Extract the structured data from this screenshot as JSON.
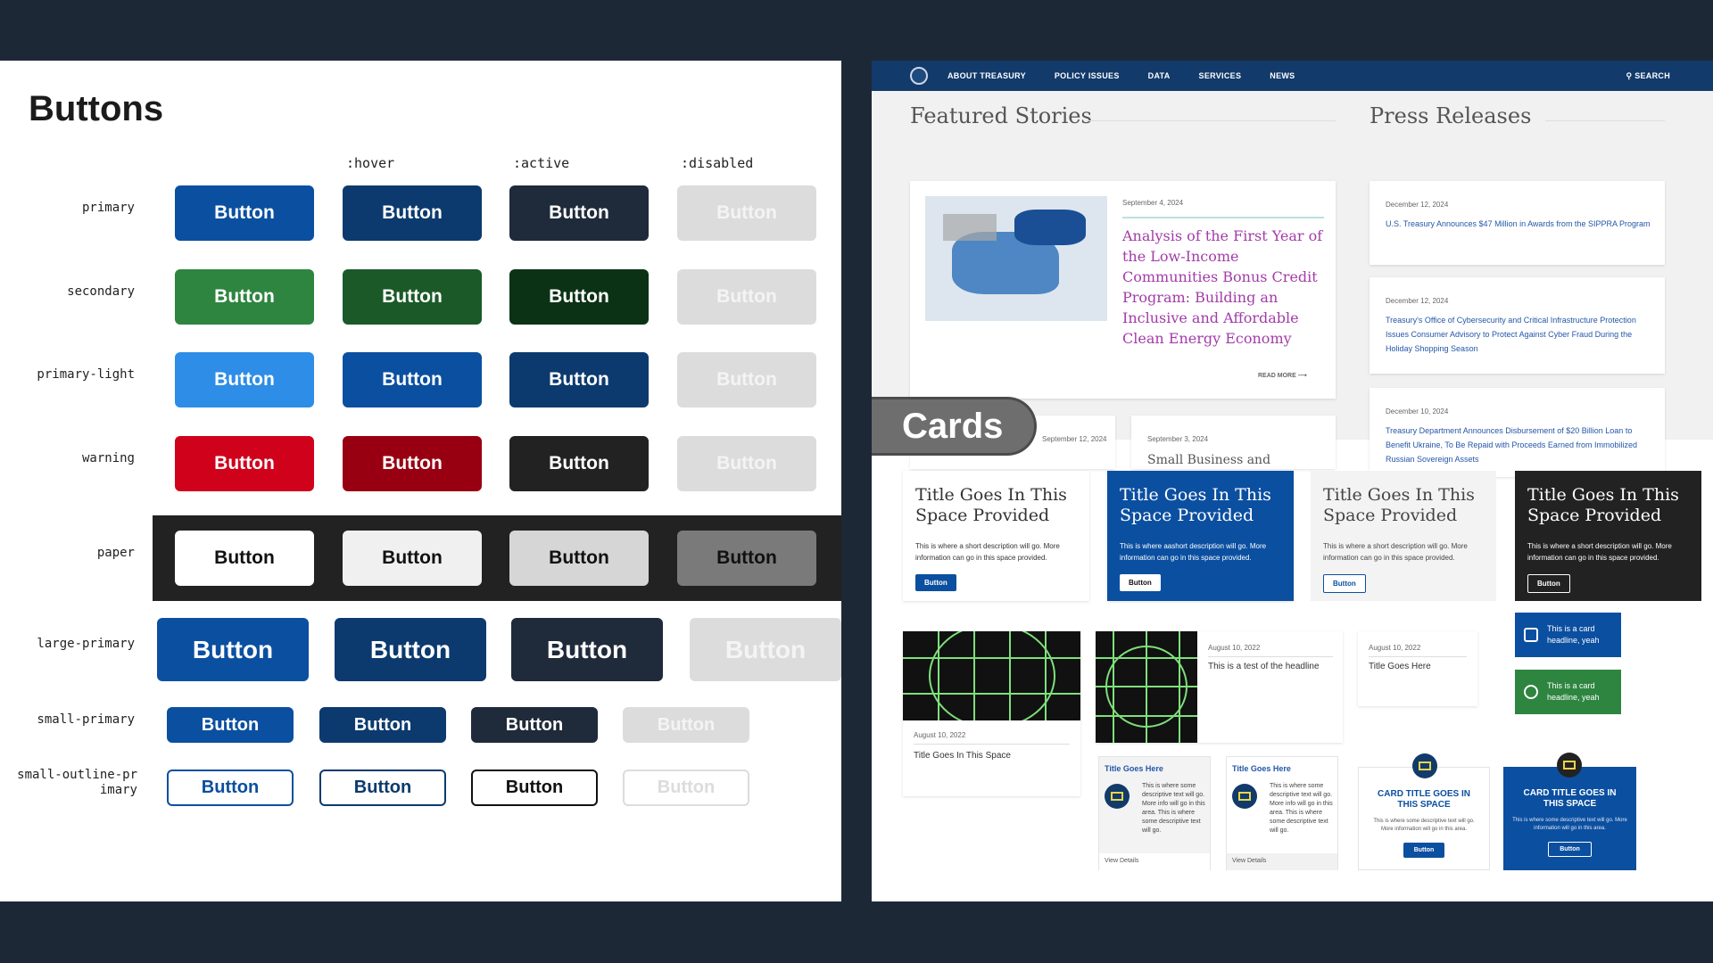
{
  "buttons_panel": {
    "title": "Buttons",
    "state_headers": [
      ":hover",
      ":active",
      ":disabled"
    ],
    "button_label": "Button",
    "rows": [
      {
        "label": "primary",
        "styles": [
          {
            "bg": "#0b4fa0",
            "fg": "#fff",
            "border": "#0b4fa0"
          },
          {
            "bg": "#0c3a6e",
            "fg": "#fff",
            "border": "#0c3a6e"
          },
          {
            "bg": "#1f2a3a",
            "fg": "#fff",
            "border": "#1f2a3a"
          },
          {
            "bg": "#dcdcdc",
            "fg": "#f4f4f4",
            "border": "#dcdcdc"
          }
        ]
      },
      {
        "label": "secondary",
        "styles": [
          {
            "bg": "#2e8540",
            "fg": "#fff",
            "border": "#2e8540"
          },
          {
            "bg": "#1b5a28",
            "fg": "#fff",
            "border": "#1b5a28"
          },
          {
            "bg": "#0c3215",
            "fg": "#fff",
            "border": "#0c3215"
          },
          {
            "bg": "#dcdcdc",
            "fg": "#f4f4f4",
            "border": "#dcdcdc"
          }
        ]
      },
      {
        "label": "primary-light",
        "styles": [
          {
            "bg": "#2e8de6",
            "fg": "#fff",
            "border": "#2e8de6"
          },
          {
            "bg": "#0b4fa0",
            "fg": "#fff",
            "border": "#0b4fa0"
          },
          {
            "bg": "#0c3a6e",
            "fg": "#fff",
            "border": "#0c3a6e"
          },
          {
            "bg": "#dcdcdc",
            "fg": "#f4f4f4",
            "border": "#dcdcdc"
          }
        ]
      },
      {
        "label": "warning",
        "styles": [
          {
            "bg": "#d0021b",
            "fg": "#fff",
            "border": "#d0021b"
          },
          {
            "bg": "#980012",
            "fg": "#fff",
            "border": "#980012"
          },
          {
            "bg": "#222222",
            "fg": "#fff",
            "border": "#222222"
          },
          {
            "bg": "#dcdcdc",
            "fg": "#f4f4f4",
            "border": "#dcdcdc"
          }
        ]
      },
      {
        "label": "paper",
        "styles": [
          {
            "bg": "#ffffff",
            "fg": "#111",
            "border": "#ffffff"
          },
          {
            "bg": "#f0f0f0",
            "fg": "#111",
            "border": "#f0f0f0"
          },
          {
            "bg": "#d6d6d6",
            "fg": "#111",
            "border": "#d6d6d6"
          },
          {
            "bg": "#7a7a7a",
            "fg": "#111",
            "border": "#7a7a7a"
          }
        ]
      },
      {
        "label": "large-primary",
        "styles": [
          {
            "bg": "#0b4fa0",
            "fg": "#fff",
            "border": "#0b4fa0"
          },
          {
            "bg": "#0c3a6e",
            "fg": "#fff",
            "border": "#0c3a6e"
          },
          {
            "bg": "#1f2a3a",
            "fg": "#fff",
            "border": "#1f2a3a"
          },
          {
            "bg": "#dcdcdc",
            "fg": "#f4f4f4",
            "border": "#dcdcdc"
          }
        ]
      },
      {
        "label": "small-primary",
        "styles": [
          {
            "bg": "#0b4fa0",
            "fg": "#fff",
            "border": "#0b4fa0"
          },
          {
            "bg": "#0c3a6e",
            "fg": "#fff",
            "border": "#0c3a6e"
          },
          {
            "bg": "#1f2a3a",
            "fg": "#fff",
            "border": "#1f2a3a"
          },
          {
            "bg": "#dcdcdc",
            "fg": "#f4f4f4",
            "border": "#dcdcdc"
          }
        ]
      },
      {
        "label": "small-outline-primary",
        "styles": [
          {
            "bg": "#fff",
            "fg": "#0b4fa0",
            "border": "#0b4fa0"
          },
          {
            "bg": "#fff",
            "fg": "#0c3a6e",
            "border": "#0c3a6e"
          },
          {
            "bg": "#fff",
            "fg": "#111",
            "border": "#111"
          },
          {
            "bg": "#fff",
            "fg": "#dcdcdc",
            "border": "#dcdcdc"
          }
        ]
      }
    ]
  },
  "site": {
    "nav": [
      "ABOUT TREASURY",
      "POLICY ISSUES",
      "DATA",
      "SERVICES",
      "NEWS"
    ],
    "search": "SEARCH",
    "featured_heading": "Featured Stories",
    "press_heading": "Press Releases",
    "featured": {
      "date": "September 4, 2024",
      "title": "Analysis of the First Year of the Low-Income Communities Bonus Credit Program: Building an Inclusive and Affordable Clean Energy Economy",
      "read_more": "READ MORE"
    },
    "small_stories": [
      {
        "date": "September 12, 2024"
      },
      {
        "date": "September 3, 2024",
        "title": "Small Business and"
      }
    ],
    "press": [
      {
        "date": "December 12, 2024",
        "title": "U.S. Treasury Announces $47 Million in Awards from the SIPPRA Program"
      },
      {
        "date": "December 12, 2024",
        "title": "Treasury's Office of Cybersecurity and Critical Infrastructure Protection Issues Consumer Advisory to Protect Against Cyber Fraud During the Holiday Shopping Season"
      },
      {
        "date": "December 10, 2024",
        "title": "Treasury Department Announces Disbursement of $20 Billion Loan to Benefit Ukraine, To Be Repaid with Proceeds Earned from Immobilized Russian Sovereign Assets"
      }
    ]
  },
  "cards_label": "Cards",
  "cards": {
    "title_cards": [
      {
        "title": "Title Goes In This Space Provided",
        "desc": "This is where a short description will go. More information can go in this space provided.",
        "button": "Button"
      },
      {
        "title": "Title Goes In This Space Provided",
        "desc": "This is where aashort description will go. More information can go in this space provided.",
        "button": "Button"
      },
      {
        "title": "Title Goes In This Space Provided",
        "desc": "This is where a short description will go. More information can go in this space provided.",
        "button": "Button"
      },
      {
        "title": "Title Goes In This Space Provided",
        "desc": "This is where a short description will go. More information can go in this space provided.",
        "button": "Button"
      }
    ],
    "headline_cards": [
      {
        "text": "This is a card headline, yeah",
        "icon": "calendar-icon"
      },
      {
        "text": "This is a card headline, yeah",
        "icon": "clock-icon"
      }
    ],
    "image_card": {
      "date": "August 10, 2022",
      "title": "Title Goes In This Space"
    },
    "horizontal_card": {
      "date": "August 10, 2022",
      "title": "This is a test of the headline"
    },
    "date_card": {
      "date": "August 10, 2022",
      "title": "Title Goes Here"
    },
    "icon_cards": [
      {
        "title": "Title Goes Here",
        "desc": "This is where some descriptive text will go. More info will go in this area. This is where some descriptive text will go.",
        "link": "View Details"
      },
      {
        "title": "Title Goes Here",
        "desc": "This is where some descriptive text will go. More info will go in this area. This is where some descriptive text will go.",
        "link": "View Details"
      }
    ],
    "cta_cards": [
      {
        "title": "CARD TITLE GOES IN THIS SPACE",
        "desc": "This is where some descriptive text will go. More information will go in this area.",
        "button": "Button"
      },
      {
        "title": "CARD TITLE GOES IN THIS SPACE",
        "desc": "This is where some descriptive text will go. More information will go in this area.",
        "button": "Button"
      }
    ]
  }
}
